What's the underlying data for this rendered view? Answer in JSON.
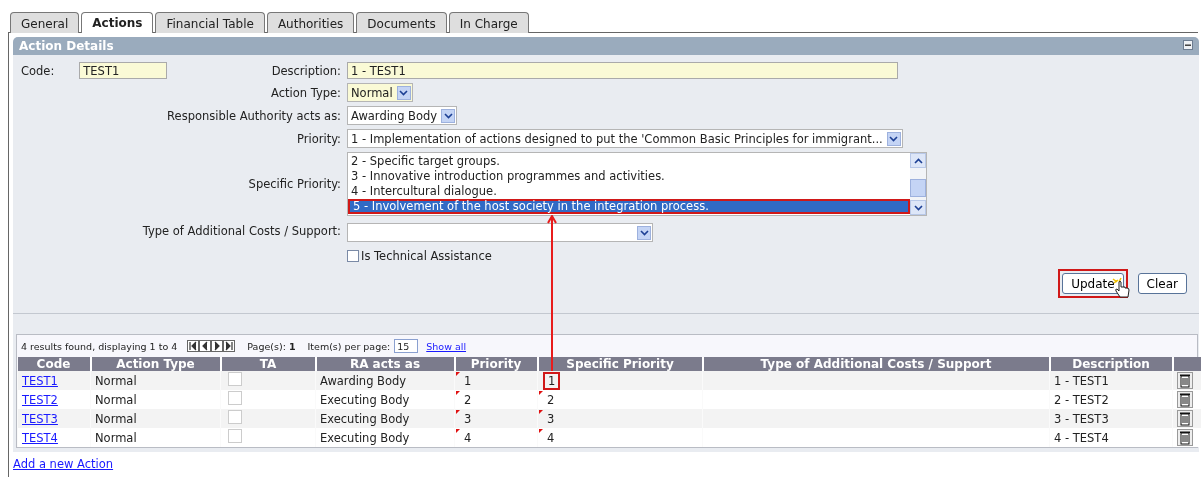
{
  "tabs": [
    {
      "label": "General",
      "selected": false
    },
    {
      "label": "Actions",
      "selected": true
    },
    {
      "label": "Financial Table",
      "selected": false
    },
    {
      "label": "Authorities",
      "selected": false
    },
    {
      "label": "Documents",
      "selected": false
    },
    {
      "label": "In Charge",
      "selected": false
    }
  ],
  "panel": {
    "title": "Action Details"
  },
  "form": {
    "code": {
      "label": "Code:",
      "value": "TEST1",
      "mandatory": true
    },
    "description": {
      "label": "Description:",
      "value": "1 - TEST1",
      "mandatory": true
    },
    "action_type": {
      "label": "Action Type:",
      "value": "Normal",
      "mandatory": true
    },
    "ra_acts_as": {
      "label": "Responsible Authority acts as:",
      "value": "Awarding Body",
      "mandatory": false
    },
    "priority": {
      "label": "Priority:",
      "value": "1 - Implementation of actions designed to put the 'Common Basic Principles for immigrant...",
      "mandatory": false
    },
    "specific_priority": {
      "label": "Specific Priority:",
      "options": [
        {
          "text": "2 - Specific target groups.",
          "selected": false,
          "highlighted": false
        },
        {
          "text": "3 - Innovative introduction programmes and activities.",
          "selected": false,
          "highlighted": false
        },
        {
          "text": "4 - Intercultural dialogue.",
          "selected": false,
          "highlighted": false
        },
        {
          "text": "5 - Involvement of the host society in the integration process.",
          "selected": true,
          "highlighted": true
        }
      ]
    },
    "additional_costs": {
      "label": "Type of Additional Costs / Support:",
      "mandatory": false
    },
    "technical_assistance": {
      "label": "Is Technical Assistance",
      "checked": false
    }
  },
  "buttons": [
    {
      "label": "Update",
      "highlighted": true
    },
    {
      "label": "Clear",
      "highlighted": false
    }
  ],
  "results": {
    "summary": "4 results found, displaying 1 to 4",
    "pages": "Page(s): **1**",
    "per_page_label": "Item(s) per page:",
    "per_page": "15",
    "show_all": "Show all"
  },
  "table": {
    "columns": [
      "Code",
      "Action Type",
      "TA",
      "RA acts as",
      "Priority",
      "Specific Priority",
      "Type of Additional Costs / Support",
      "Description"
    ],
    "rows": [
      {
        "code": "TEST1",
        "action_type": "Normal",
        "ta_checked": false,
        "ra_acts_as": "Awarding Body",
        "priority": "1",
        "priority_changed": true,
        "specific_priority": "1",
        "specific_changed": false,
        "specific_highlighted": true,
        "description": "1 - TEST1"
      },
      {
        "code": "TEST2",
        "action_type": "Normal",
        "ta_checked": false,
        "ra_acts_as": "Executing Body",
        "priority": "2",
        "priority_changed": true,
        "specific_priority": "2",
        "specific_changed": true,
        "specific_highlighted": false,
        "description": "2 - TEST2"
      },
      {
        "code": "TEST3",
        "action_type": "Normal",
        "ta_checked": false,
        "ra_acts_as": "Executing Body",
        "priority": "3",
        "priority_changed": true,
        "specific_priority": "3",
        "specific_changed": true,
        "specific_highlighted": false,
        "description": "3 - TEST3"
      },
      {
        "code": "TEST4",
        "action_type": "Normal",
        "ta_checked": false,
        "ra_acts_as": "Executing Body",
        "priority": "4",
        "priority_changed": true,
        "specific_priority": "4",
        "specific_changed": true,
        "specific_highlighted": false,
        "description": "4 - TEST4"
      }
    ]
  },
  "add_link": "Add a new Action"
}
